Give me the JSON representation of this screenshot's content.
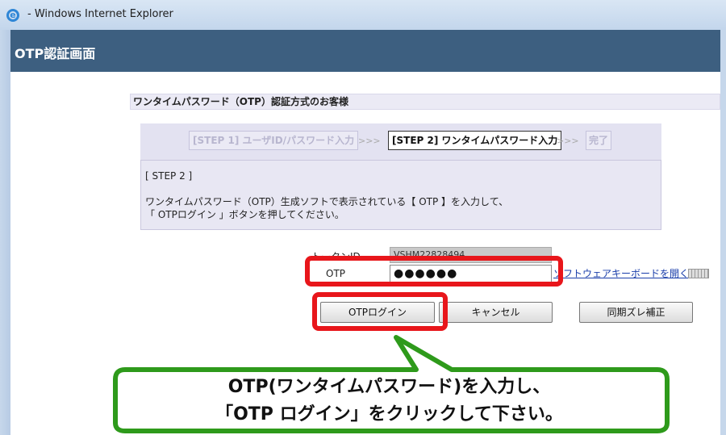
{
  "window": {
    "title": "- Windows Internet Explorer"
  },
  "header": {
    "title": "OTP認証画面"
  },
  "section": {
    "title": "ワンタイムパスワード（OTP）認証方式のお客様"
  },
  "steps": {
    "step1": "[STEP 1] ユーザID/パスワード入力",
    "sep1": ">>>",
    "step2": "[STEP 2] ワンタイムパスワード入力",
    "sep2": ">>>",
    "done": "完了"
  },
  "instructions": {
    "step_label": "[ STEP 2 ]",
    "line1": "ワンタイムパスワード（OTP）生成ソフトで表示されている【 OTP 】を入力して、",
    "line2": "「 OTPログイン 」ボタンを押してください。"
  },
  "form": {
    "token_label": "トークンID",
    "token_value": "VSHM22828494",
    "otp_label": "OTP",
    "otp_value": "●●●●●●",
    "keyboard_link": "ソフトウェアキーボードを開く"
  },
  "buttons": {
    "login": "OTPログイン",
    "cancel": "キャンセル",
    "sync": "同期ズレ補正"
  },
  "callout": {
    "line1": "OTP(ワンタイムパスワード)を入力し、",
    "line2": "「OTP ログイン」をクリックして下さい。"
  },
  "colors": {
    "header_bg": "#3d5f80",
    "highlight": "#e8161b",
    "callout_border": "#2e9a1b"
  }
}
